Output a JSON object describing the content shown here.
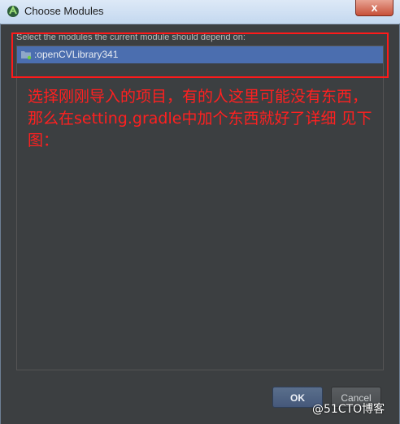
{
  "window": {
    "title": "Choose Modules",
    "close_glyph": "x"
  },
  "dialog": {
    "prompt": "Select the modules the current module should depend on:",
    "modules": [
      {
        "label": ":openCVLibrary341",
        "icon": "module-folder-icon",
        "selected": true
      }
    ]
  },
  "annotation": {
    "text": "选择刚刚导入的项目，有的人这里可能没有东西，那么在setting.gradle中加个东西就好了详细 见下图：",
    "color": "#ff2020"
  },
  "buttons": {
    "ok": "OK",
    "cancel": "Cancel"
  },
  "watermark": "@51CTO博客",
  "colors": {
    "selection": "#4b6eaf",
    "background": "#3c3f41",
    "highlight_border": "#ff1a1a"
  }
}
